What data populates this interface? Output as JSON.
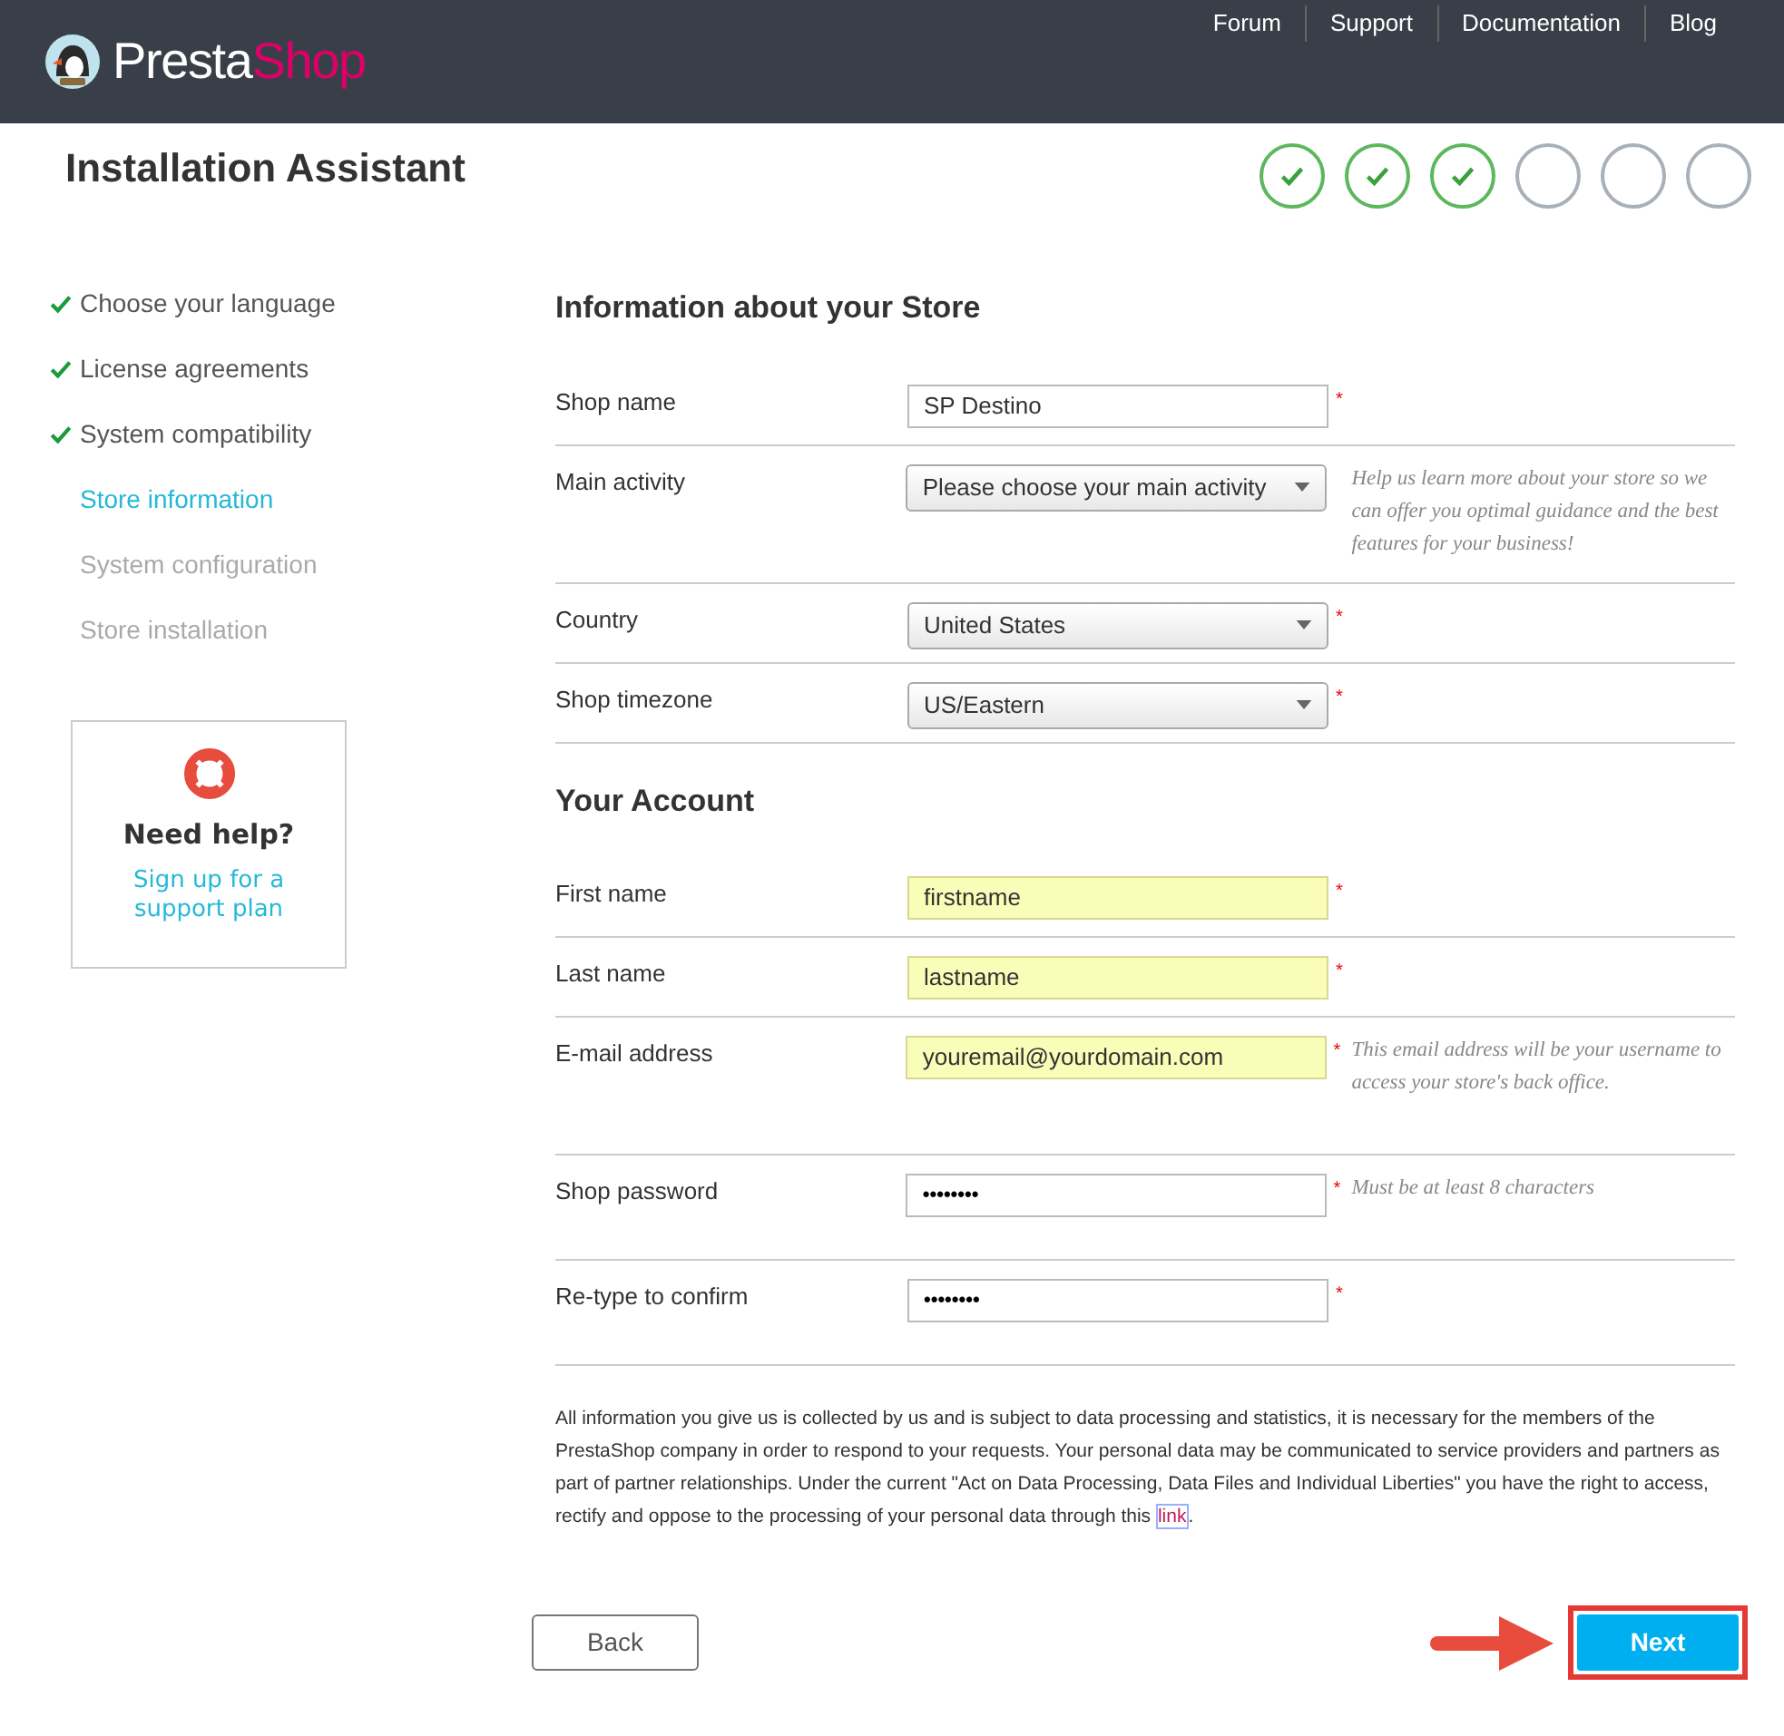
{
  "header": {
    "logo": {
      "part_1": "Presta",
      "part_2": "Shop"
    },
    "links": [
      "Forum",
      "Support",
      "Documentation",
      "Blog"
    ]
  },
  "title": "Installation Assistant",
  "progress": [
    {
      "done": true
    },
    {
      "done": true
    },
    {
      "done": true
    },
    {
      "done": false
    },
    {
      "done": false
    },
    {
      "done": false
    }
  ],
  "sidebar": {
    "steps": [
      {
        "label": "Choose your language",
        "done": true,
        "selected": false
      },
      {
        "label": "License agreements",
        "done": true,
        "selected": false
      },
      {
        "label": "System compatibility",
        "done": true,
        "selected": false
      },
      {
        "label": "Store information",
        "done": false,
        "selected": true
      },
      {
        "label": "System configuration",
        "done": false,
        "selected": false
      },
      {
        "label": "Store installation",
        "done": false,
        "selected": false
      }
    ],
    "help": {
      "title": "Need help?",
      "link": "Sign up for a support plan"
    }
  },
  "sections": [
    {
      "title": "Information about your Store",
      "fields": [
        {
          "label": "Shop name",
          "kind": "text",
          "value": "SP Destino",
          "required_mark": "*",
          "highlighted": false
        },
        {
          "label": "Main activity",
          "kind": "select",
          "value": "Please choose your main activity",
          "hint": "Help us learn more about your store so we can offer you optimal guidance and the best features for your business!"
        },
        {
          "label": "Country",
          "kind": "select",
          "value": "United States",
          "required_mark": "*"
        },
        {
          "label": "Shop timezone",
          "kind": "select",
          "value": "US/Eastern",
          "required_mark": "*"
        }
      ]
    },
    {
      "title": "Your Account",
      "fields": [
        {
          "label": "First name",
          "kind": "text",
          "value": "firstname",
          "required_mark": "*",
          "highlighted": true
        },
        {
          "label": "Last name",
          "kind": "text",
          "value": "lastname",
          "required_mark": "*",
          "highlighted": true
        },
        {
          "label": "E-mail address",
          "kind": "text",
          "value": "youremail@yourdomain.com",
          "required_mark": "*",
          "highlighted": true,
          "hint": "This email address will be your username to access your store's back office."
        },
        {
          "label": "Shop password",
          "kind": "password",
          "value": "••••••••",
          "required_mark": "*",
          "highlighted": false,
          "hint": "Must be at least 8 characters"
        },
        {
          "label": "Re-type to confirm",
          "kind": "password",
          "value": "••••••••",
          "required_mark": "*",
          "highlighted": false
        }
      ]
    }
  ],
  "notice": {
    "text": "All information you give us is collected by us and is subject to data processing and statistics, it is necessary for the members of the PrestaShop company in order to respond to your requests. Your personal data may be communicated to service providers and partners as part of partner relationships. Under the current \"Act on Data Processing, Data Files and Individual Liberties\" you have the right to access, rectify and oppose to the processing of your personal data through this",
    "link": "link",
    "text_after": "."
  },
  "buttons": {
    "back": "Back",
    "next": "Next"
  }
}
